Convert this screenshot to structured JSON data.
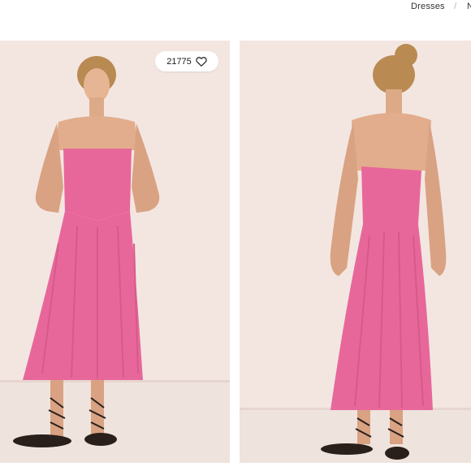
{
  "breadcrumb": {
    "current": "Dresses",
    "separator": "/",
    "next": "N"
  },
  "like": {
    "count": "21775",
    "icon": "heart-icon"
  },
  "colors": {
    "dress": "#e8679a",
    "background": "#f3e6e1"
  },
  "photos": [
    {
      "view": "front"
    },
    {
      "view": "back"
    }
  ]
}
